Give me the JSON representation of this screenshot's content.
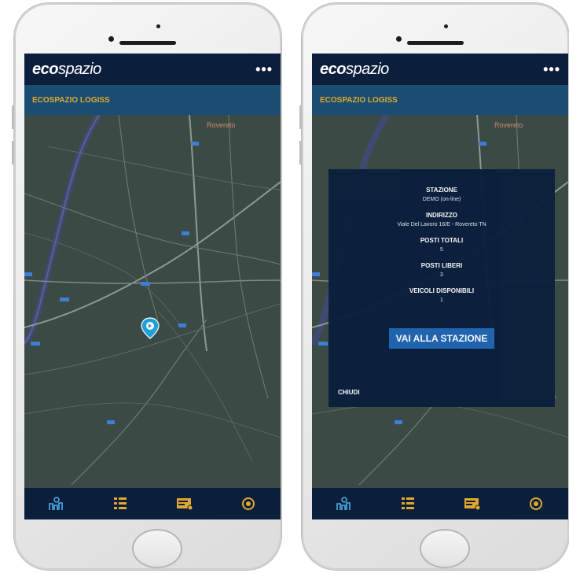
{
  "app": {
    "logo_bold": "eco",
    "logo_light": "spazio",
    "menu_label": "•••",
    "subtitle": "ECOSPAZIO LOGISS"
  },
  "map": {
    "labels": [
      "Rovereto"
    ],
    "pin_icon": "map-pin-icon"
  },
  "bottom_nav": [
    {
      "icon": "map-stations-icon"
    },
    {
      "icon": "list-icon"
    },
    {
      "icon": "card-icon"
    },
    {
      "icon": "location-target-icon"
    }
  ],
  "station_popup": {
    "station_label": "STAZIONE",
    "station_value": "DEMO (on-line)",
    "address_label": "INDIRIZZO",
    "address_value": "Viale Del Lavoro 16/E - Rovereto TN",
    "total_label": "POSTI TOTALI",
    "total_value": "5",
    "free_label": "POSTI LIBERI",
    "free_value": "3",
    "vehicles_label": "VEICOLI DISPONIBILI",
    "vehicles_value": "1",
    "go_button": "VAI ALLA STAZIONE",
    "close_button": "CHIUDI"
  },
  "colors": {
    "header": "#0b1f3d",
    "subheader": "#1a4d72",
    "accent": "#e0a82e",
    "map_bg": "#3b4a44",
    "button": "#1f65b3"
  }
}
